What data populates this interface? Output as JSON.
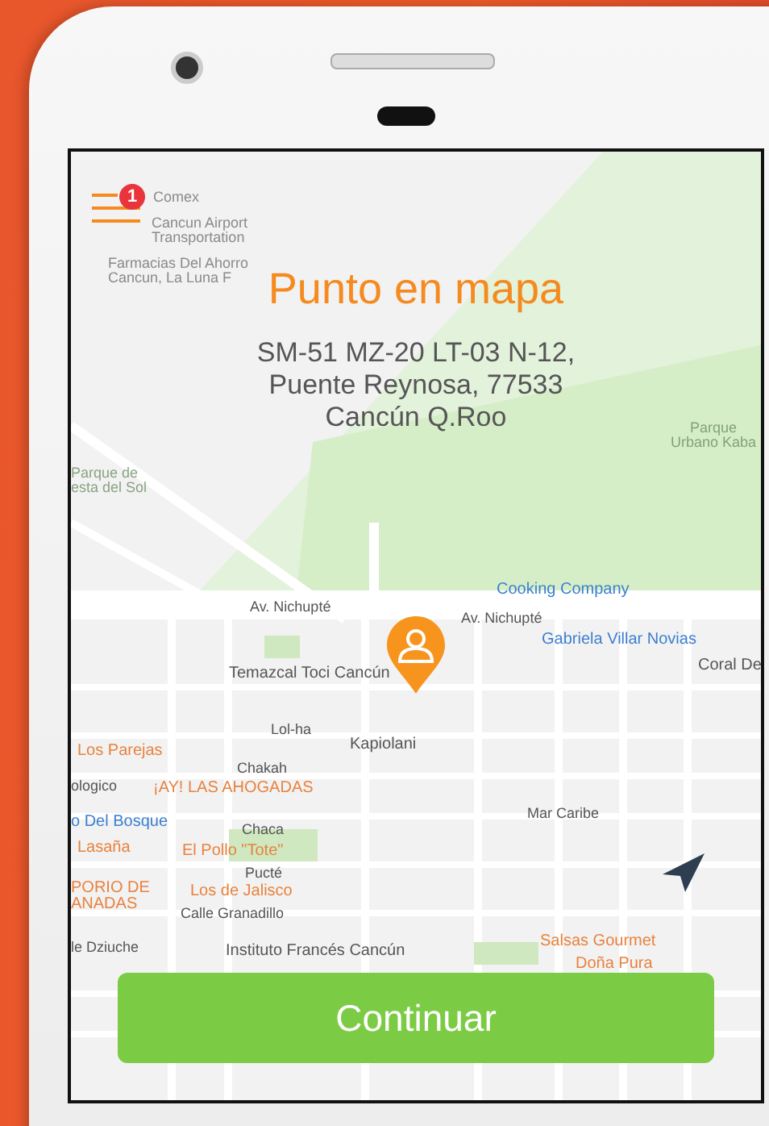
{
  "header": {
    "menu_badge": "1",
    "title": "Punto en mapa",
    "address": [
      "SM-51 MZ-20 LT-03 N-12,",
      "Puente Reynosa, 77533",
      "Cancún Q.Roo"
    ]
  },
  "map": {
    "labels": [
      {
        "text": "Comex",
        "kind": "faded"
      },
      {
        "text": "Cancun Airport",
        "kind": "faded"
      },
      {
        "text": "Transportation",
        "kind": "faded"
      },
      {
        "text": "Farmacias Del Ahorro",
        "kind": "faded"
      },
      {
        "text": "Cancun, La Luna F",
        "kind": "faded"
      },
      {
        "text": "Parque",
        "kind": "park"
      },
      {
        "text": "Urbano Kaba",
        "kind": "park"
      },
      {
        "text": "Parque de",
        "kind": "park"
      },
      {
        "text": "esta del Sol",
        "kind": "park"
      },
      {
        "text": "Cooking Company",
        "kind": "shop"
      },
      {
        "text": "Av. Nichupté",
        "kind": "street"
      },
      {
        "text": "Av. Nichupté",
        "kind": "street"
      },
      {
        "text": "Gabriela Villar Novias",
        "kind": "shop"
      },
      {
        "text": "Coral De",
        "kind": "place"
      },
      {
        "text": "Temazcal Toci Cancún",
        "kind": "place"
      },
      {
        "text": "Lol-ha",
        "kind": "street"
      },
      {
        "text": "Kapiolani",
        "kind": "place"
      },
      {
        "text": "Los Parejas",
        "kind": "food"
      },
      {
        "text": "Chakah",
        "kind": "street"
      },
      {
        "text": "ologico",
        "kind": "street"
      },
      {
        "text": "¡AY! LAS AHOGADAS",
        "kind": "food"
      },
      {
        "text": "Mar Caribe",
        "kind": "street"
      },
      {
        "text": "o Del Bosque",
        "kind": "shop"
      },
      {
        "text": "Chaca",
        "kind": "street"
      },
      {
        "text": "Lasaña",
        "kind": "food"
      },
      {
        "text": "El Pollo \"Tote\"",
        "kind": "food"
      },
      {
        "text": "Pucté",
        "kind": "street"
      },
      {
        "text": "PORIO DE",
        "kind": "food"
      },
      {
        "text": "Los de Jalisco",
        "kind": "food"
      },
      {
        "text": "ANADAS",
        "kind": "food"
      },
      {
        "text": "Calle Granadillo",
        "kind": "street"
      },
      {
        "text": "Salsas Gourmet",
        "kind": "food"
      },
      {
        "text": "le Dziuche",
        "kind": "street"
      },
      {
        "text": "Instituto Francés Cancún",
        "kind": "place"
      },
      {
        "text": "Doña Pura",
        "kind": "food"
      }
    ]
  },
  "button": {
    "label": "Continuar"
  }
}
